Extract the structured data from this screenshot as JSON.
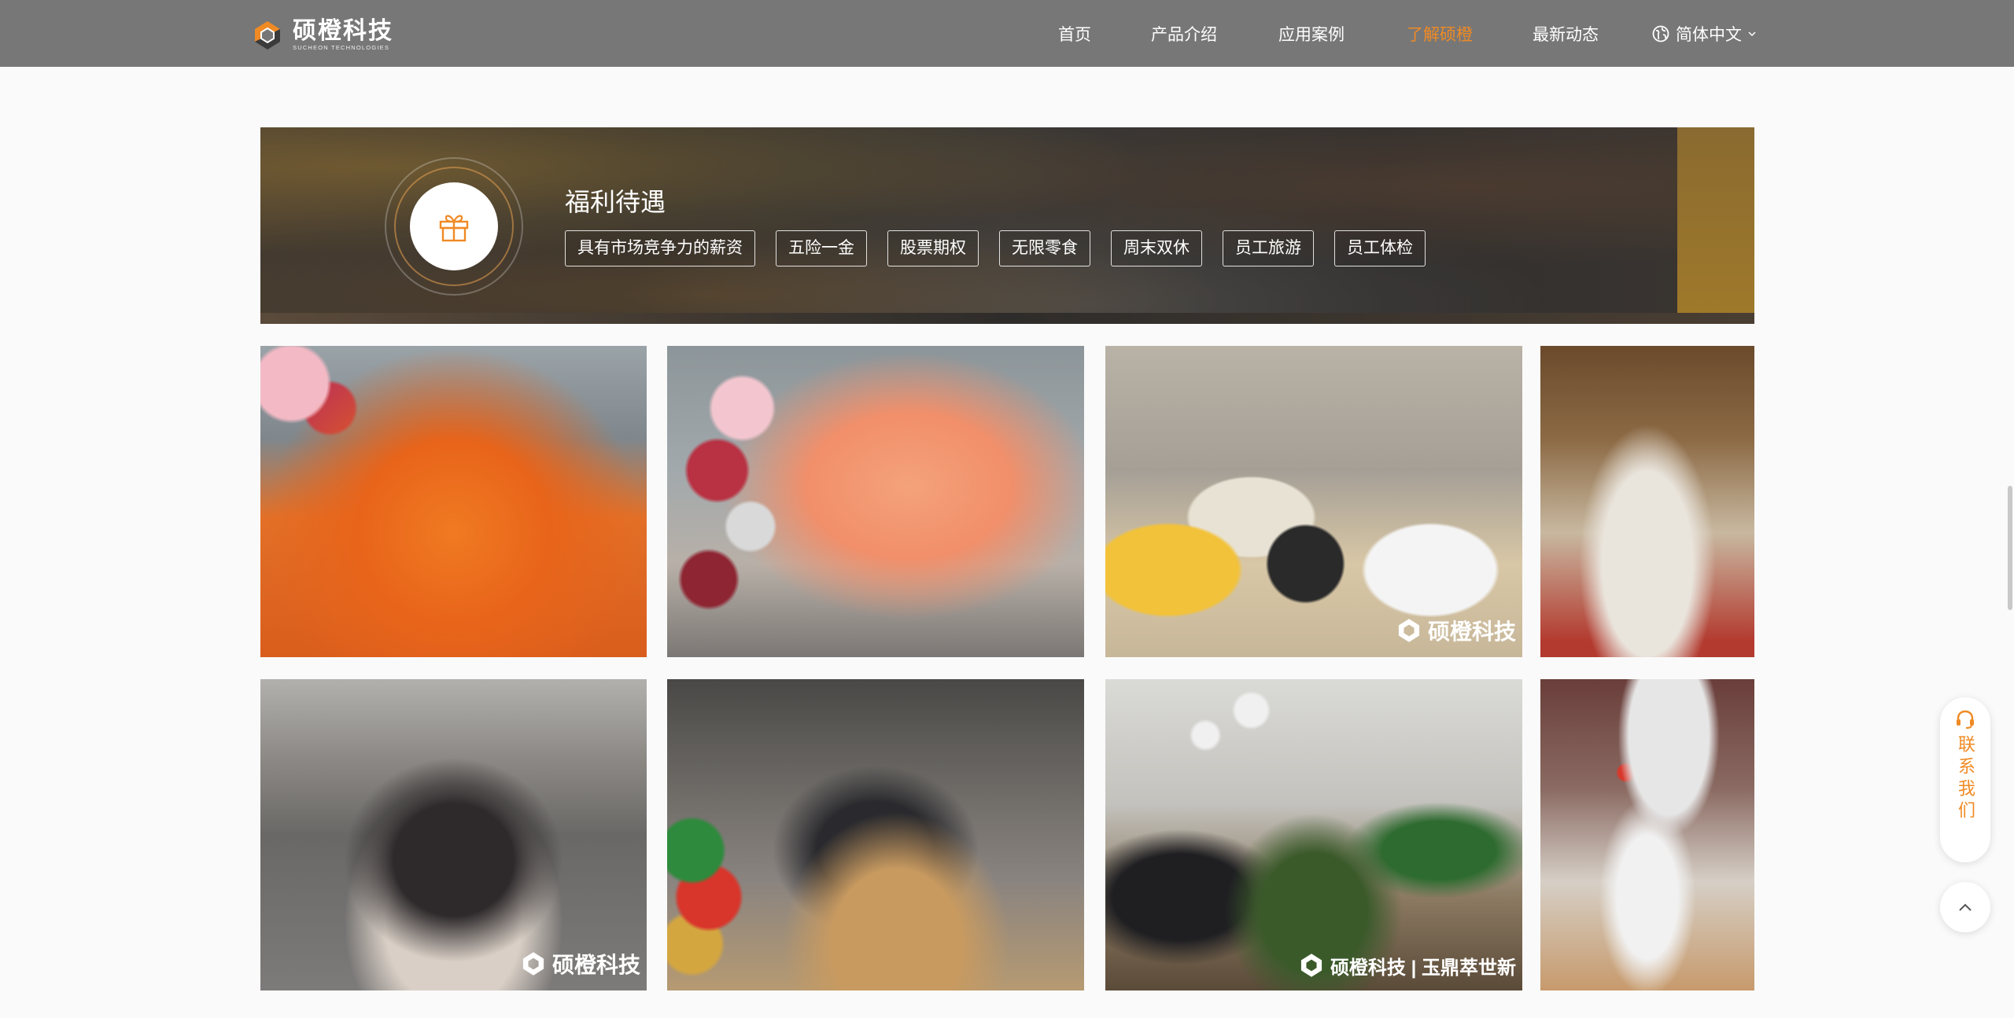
{
  "header": {
    "logo_cn": "硕橙科技",
    "logo_en": "SUCHEON TECHNOLOGIES",
    "nav": [
      {
        "label": "首页",
        "active": false
      },
      {
        "label": "产品介绍",
        "active": false
      },
      {
        "label": "应用案例",
        "active": false
      },
      {
        "label": "了解硕橙",
        "active": true
      },
      {
        "label": "最新动态",
        "active": false
      }
    ],
    "language": "简体中文",
    "globe_icon": "globe-icon",
    "chevron_icon": "chevron-down-icon"
  },
  "benefits": {
    "title": "福利待遇",
    "icon": "gift-icon",
    "tags": [
      "具有市场竞争力的薪资",
      "五险一金",
      "股票期权",
      "无限零食",
      "周末双休",
      "员工旅游",
      "员工体检"
    ]
  },
  "photos": [
    {
      "name": "photo-orange-team",
      "watermark": ""
    },
    {
      "name": "photo-balloon-arch",
      "watermark": ""
    },
    {
      "name": "photo-meeting-audience",
      "watermark": "硕橙科技"
    },
    {
      "name": "photo-group-seated",
      "watermark": ""
    },
    {
      "name": "photo-company-group",
      "watermark": "硕橙科技"
    },
    {
      "name": "photo-snack-party",
      "watermark": ""
    },
    {
      "name": "photo-flower-workshop",
      "watermark": "硕橙科技 | 玉鼎萃世新"
    },
    {
      "name": "photo-banquet-hall",
      "watermark": ""
    }
  ],
  "floating": {
    "contact_label": "联系我们",
    "contact_icon": "headset-icon",
    "top_icon": "chevron-up-icon"
  },
  "colors": {
    "accent": "#f08a24",
    "header_bg": "#777777",
    "page_bg": "#fafafa"
  }
}
